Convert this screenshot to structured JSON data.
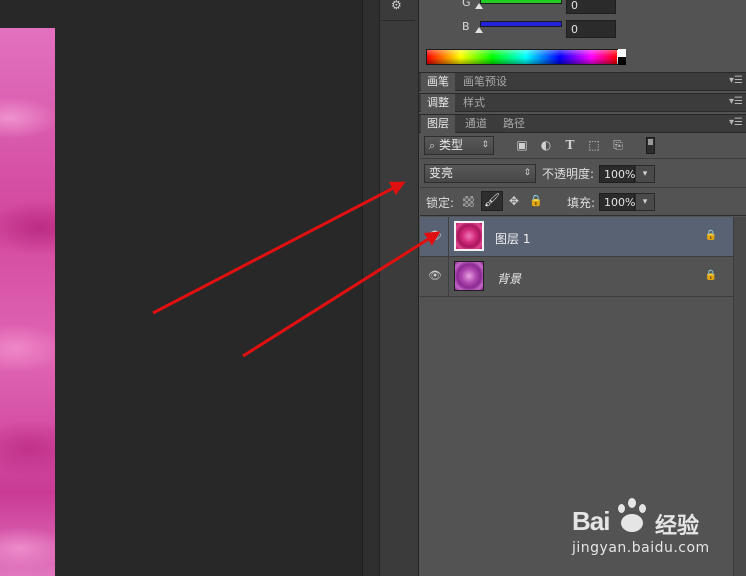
{
  "color_panel": {
    "g_label": "G",
    "b_label": "B",
    "g_value": "0",
    "b_value": "0",
    "g_slider_color": "#22cc22",
    "b_slider_color": "#2222dd"
  },
  "brush_tabs": {
    "brush": "画笔",
    "brush_presets": "画笔预设"
  },
  "adjust_tabs": {
    "adjustments": "调整",
    "styles": "样式"
  },
  "layer_tabs": {
    "layers": "图层",
    "channels": "通道",
    "paths": "路径"
  },
  "layers_panel": {
    "filter_kind": "类型",
    "blend_mode": "变亮",
    "opacity_label": "不透明度:",
    "opacity_value": "100%",
    "lock_label": "锁定:",
    "fill_label": "填充:",
    "fill_value": "100%",
    "layers": [
      {
        "name": "图层 1",
        "selected": true,
        "locked": false
      },
      {
        "name": "背景",
        "selected": false,
        "locked": true
      }
    ]
  },
  "watermark": {
    "brand_latin": "Bai",
    "brand_suffix": "经验",
    "url": "jingyan.baidu.com"
  },
  "colors": {
    "panel_bg": "#535353",
    "selected_row": "#596273",
    "arrow_red": "#e01010",
    "canvas_pink": "#d94ca6"
  }
}
